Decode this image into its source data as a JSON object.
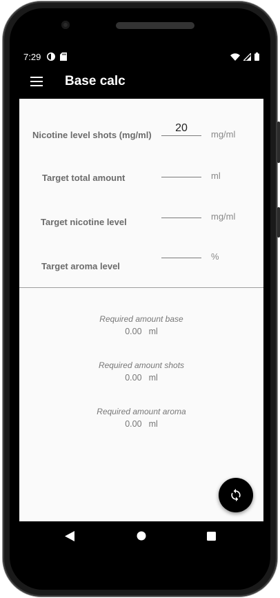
{
  "status_bar": {
    "time": "7:29"
  },
  "app_bar": {
    "title": "Base calc"
  },
  "inputs": [
    {
      "label": "Nicotine level shots (mg/ml)",
      "value": "20",
      "unit": "mg/ml"
    },
    {
      "label": "Target total amount",
      "value": "",
      "unit": "ml"
    },
    {
      "label": "Target nicotine level",
      "value": "",
      "unit": "mg/ml"
    },
    {
      "label": "Target aroma level",
      "value": "",
      "unit": "%"
    }
  ],
  "results": [
    {
      "label": "Required amount base",
      "value": "0.00",
      "unit": "ml"
    },
    {
      "label": "Required amount shots",
      "value": "0.00",
      "unit": "ml"
    },
    {
      "label": "Required amount aroma",
      "value": "0.00",
      "unit": "ml"
    }
  ],
  "fab": {
    "icon": "refresh-icon"
  },
  "colors": {
    "app_bar": "#000000",
    "background": "#fafafa",
    "label_text": "#6b6b6b"
  }
}
